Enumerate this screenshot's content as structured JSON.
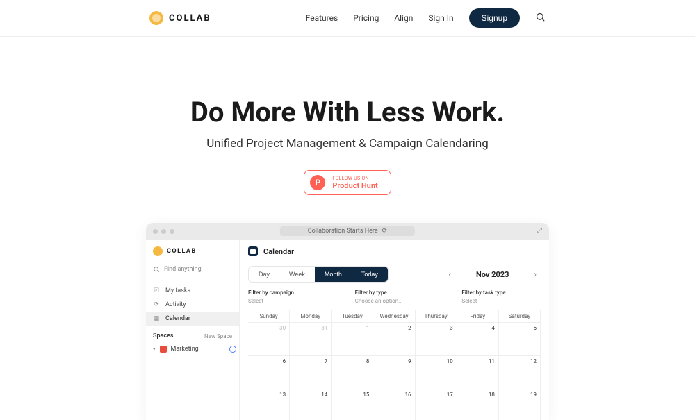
{
  "brand": "COLLAB",
  "nav": {
    "features": "Features",
    "pricing": "Pricing",
    "align": "Align",
    "signin": "Sign In",
    "signup": "Signup"
  },
  "hero": {
    "title": "Do More With Less Work.",
    "subtitle": "Unified Project Management & Campaign Calendaring",
    "ph_top": "FOLLOW US ON",
    "ph_bottom": "Product Hunt"
  },
  "preview": {
    "titlebar": "Collaboration Starts Here"
  },
  "sidebar": {
    "search_placeholder": "Find anything",
    "items": [
      {
        "label": "My tasks",
        "icon": "☑"
      },
      {
        "label": "Activity",
        "icon": "⟳"
      },
      {
        "label": "Calendar",
        "icon": "▦"
      }
    ],
    "spaces_title": "Spaces",
    "spaces_action": "New Space",
    "spaces": [
      {
        "label": "Marketing"
      }
    ]
  },
  "calendar": {
    "title": "Calendar",
    "views": {
      "day": "Day",
      "week": "Week",
      "month": "Month",
      "today": "Today"
    },
    "month_label": "Nov 2023",
    "filters": {
      "campaign_label": "Filter by campaign",
      "campaign_value": "Select",
      "type_label": "Filter by type",
      "type_value": "Choose an option...",
      "task_label": "Filter by task type",
      "task_value": "Select"
    },
    "day_names": [
      "Sunday",
      "Monday",
      "Tuesday",
      "Wednesday",
      "Thursday",
      "Friday",
      "Saturday"
    ],
    "weeks": [
      [
        {
          "n": "30",
          "m": true
        },
        {
          "n": "31",
          "m": true
        },
        {
          "n": "1"
        },
        {
          "n": "2"
        },
        {
          "n": "3"
        },
        {
          "n": "4"
        },
        {
          "n": "5"
        }
      ],
      [
        {
          "n": "6"
        },
        {
          "n": "7"
        },
        {
          "n": "8"
        },
        {
          "n": "9"
        },
        {
          "n": "10"
        },
        {
          "n": "11"
        },
        {
          "n": "12"
        }
      ],
      [
        {
          "n": "13"
        },
        {
          "n": "14"
        },
        {
          "n": "15"
        },
        {
          "n": "16"
        },
        {
          "n": "17"
        },
        {
          "n": "18"
        },
        {
          "n": "19"
        }
      ]
    ]
  }
}
